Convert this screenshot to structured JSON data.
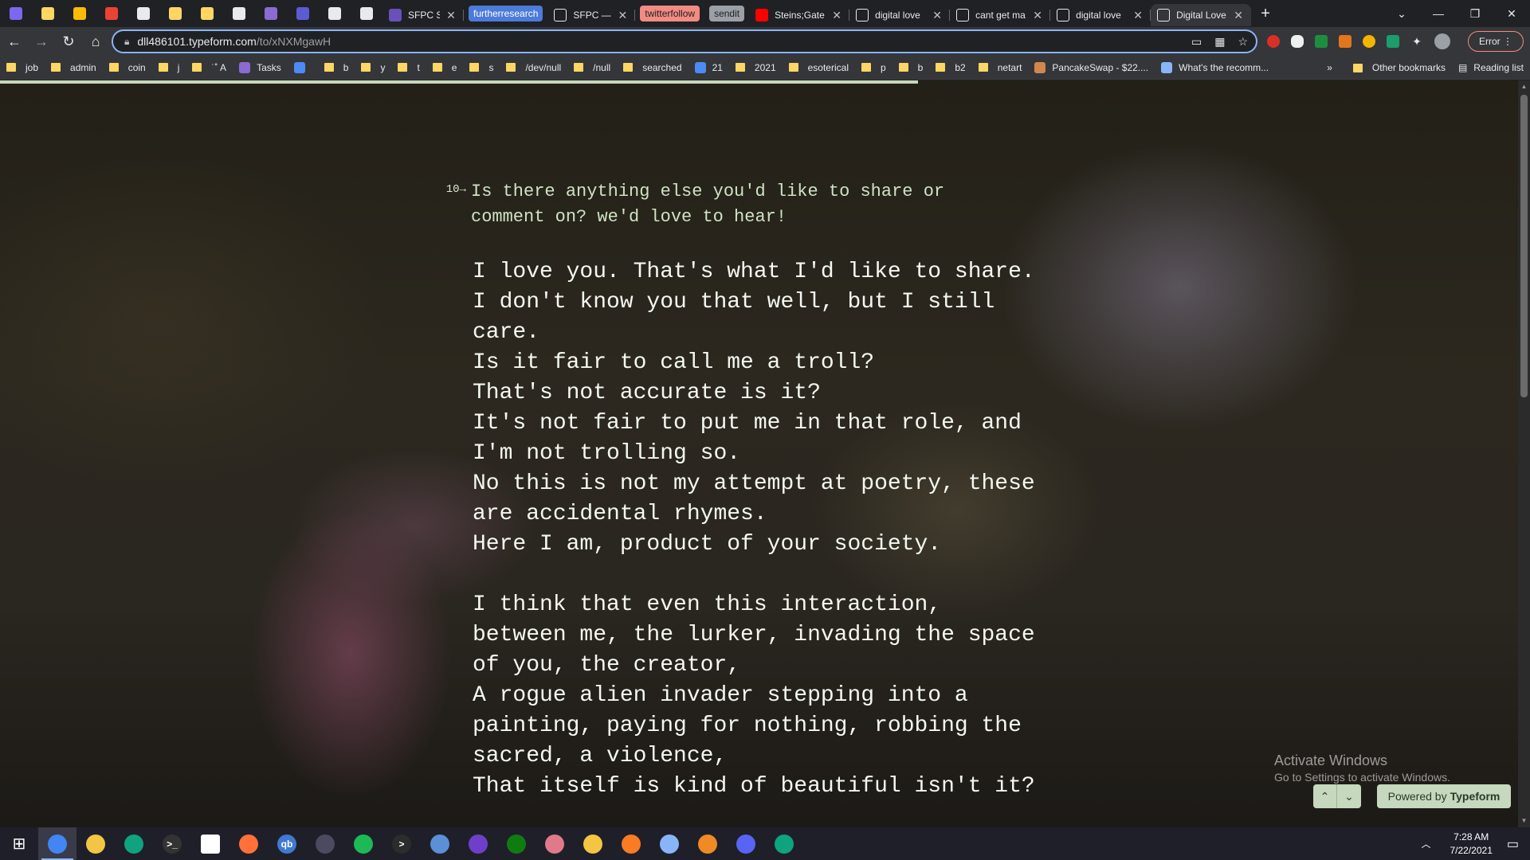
{
  "browser": {
    "pinned_tabs": [
      {
        "icon": "messenger-icon",
        "color": "#7b68ee"
      },
      {
        "icon": "g-icon",
        "color": "#fdd663"
      },
      {
        "icon": "google-keep-icon",
        "color": "#fbbc04"
      },
      {
        "icon": "gmail-icon",
        "color": "#ea4335"
      },
      {
        "icon": "circle-icon",
        "color": "#e8eaed"
      },
      {
        "icon": "notes-icon",
        "color": "#fdd663"
      },
      {
        "icon": "notes-icon",
        "color": "#fdd663"
      },
      {
        "icon": "grid-icon",
        "color": "#e8eaed"
      },
      {
        "icon": "puzzle-icon",
        "color": "#8a6bd1"
      },
      {
        "icon": "ring-icon",
        "color": "#5b5bd6"
      },
      {
        "icon": "circle-icon",
        "color": "#e8eaed"
      },
      {
        "icon": "square-icon",
        "color": "#e8eaed"
      }
    ],
    "tabs": [
      {
        "title": "SFPC Summ",
        "icon": "form-icon",
        "icon_color": "#6b4fbb",
        "width": 102,
        "close": "✕"
      },
      {
        "chip": "furtherresearch",
        "chip_bg": "#4c7bd9",
        "chip_fg": "#ffffff"
      },
      {
        "title": "SFPC — CO",
        "icon": "feather-icon",
        "icon_color": "#e8eaed",
        "width": 110,
        "close": "✕"
      },
      {
        "chip": "twitterfollow",
        "chip_bg": "#f28b82",
        "chip_fg": "#202124"
      },
      {
        "chip": "sendit",
        "chip_bg": "#9aa0a6",
        "chip_fg": "#202124"
      },
      {
        "title": "Steins;Gate",
        "icon": "youtube-icon",
        "icon_color": "#ff0000",
        "width": 126,
        "close": "✕"
      },
      {
        "title": "digital love",
        "icon": "heart-icon",
        "icon_color": "#e8eaed",
        "width": 126,
        "close": "✕"
      },
      {
        "title": "cant get ma",
        "icon": "google-icon",
        "icon_color": "#e8eaed",
        "width": 126,
        "close": "✕"
      },
      {
        "title": "digital love",
        "icon": "heart-icon",
        "icon_color": "#e8eaed",
        "width": 126,
        "close": "✕"
      },
      {
        "title": "Digital Love",
        "icon": "typeform-icon",
        "icon_color": "#e8eaed",
        "width": 126,
        "close": "✕",
        "active": true
      }
    ],
    "new_tab": "+",
    "url_host": "dll486101.typeform.com",
    "url_path": "/to/xNXMgawH",
    "error_label": "Error",
    "bookmarks": [
      {
        "label": "job",
        "type": "folder"
      },
      {
        "label": "admin",
        "type": "folder"
      },
      {
        "label": "coin",
        "type": "folder"
      },
      {
        "label": "j",
        "type": "folder"
      },
      {
        "label": "˙˚ A",
        "type": "folder"
      },
      {
        "label": "Tasks",
        "type": "site",
        "color": "#8a6bd1"
      },
      {
        "label": "",
        "type": "site",
        "color": "#4c8bf5"
      },
      {
        "label": "b",
        "type": "folder"
      },
      {
        "label": "y",
        "type": "folder"
      },
      {
        "label": "t",
        "type": "folder"
      },
      {
        "label": "e",
        "type": "folder"
      },
      {
        "label": "s",
        "type": "folder"
      },
      {
        "label": "/dev/null",
        "type": "folder"
      },
      {
        "label": "/null",
        "type": "folder"
      },
      {
        "label": "searched",
        "type": "folder"
      },
      {
        "label": "21",
        "type": "site",
        "color": "#4c8bf5"
      },
      {
        "label": "2021",
        "type": "folder"
      },
      {
        "label": "esoterical",
        "type": "folder"
      },
      {
        "label": "p",
        "type": "folder"
      },
      {
        "label": "b",
        "type": "folder"
      },
      {
        "label": "b2",
        "type": "folder"
      },
      {
        "label": "netart",
        "type": "folder"
      },
      {
        "label": "PancakeSwap - $22....",
        "type": "site",
        "color": "#d1884f"
      },
      {
        "label": "What's the recomm...",
        "type": "site",
        "color": "#8ab4f8"
      }
    ],
    "bookmarks_more": "»",
    "other_bookmarks": "Other bookmarks",
    "reading_list": "Reading list"
  },
  "form": {
    "progress": 0.6,
    "question_number": "10→",
    "question": "Is there anything else you'd like to share or comment on? we'd love to hear!",
    "answer": "I love you. That's what I'd like to share. I don't know you that well, but I still care.\nIs it fair to call me a troll?\nThat's not accurate is it?\nIt's not fair to put me in that role, and I'm not trolling so.\nNo this is not my attempt at poetry, these are accidental rhymes.\nHere I am, product of your society.\n\nI think that even this interaction, between me, the lurker, invading the space of you, the creator,\nA rogue alien invader stepping into a painting, paying for nothing, robbing the sacred, a violence,\nThat itself is kind of beautiful isn't it?",
    "nav_up": "⌃",
    "nav_down": "⌄",
    "powered_by": "Powered by",
    "powered_brand": "Typeform"
  },
  "watermark": {
    "line1": "Activate Windows",
    "line2": "Go to Settings to activate Windows."
  },
  "taskbar": {
    "apps": [
      {
        "icon": "windows-start-icon",
        "color": "#1f1f2a",
        "glyph": "⊞"
      },
      {
        "icon": "chrome-icon",
        "color": "#4285f4",
        "active": true
      },
      {
        "icon": "file-explorer-icon",
        "color": "#f4c542"
      },
      {
        "icon": "chatgpt-icon",
        "color": "#10a37f"
      },
      {
        "icon": "terminal-icon",
        "color": "#333333",
        "glyph": ">_"
      },
      {
        "icon": "window-icon",
        "color": "#ffffff"
      },
      {
        "icon": "firefox-icon",
        "color": "#ff7139"
      },
      {
        "icon": "qbittorrent-icon",
        "color": "#3f79d3",
        "glyph": "qb"
      },
      {
        "icon": "vpn-icon",
        "color": "#4a4a60"
      },
      {
        "icon": "spotify-icon",
        "color": "#1db954"
      },
      {
        "icon": "shell-icon",
        "color": "#2c2c2c",
        "glyph": ">"
      },
      {
        "icon": "virtualbox-icon",
        "color": "#5b8fd6"
      },
      {
        "icon": "github-icon",
        "color": "#6e40c9"
      },
      {
        "icon": "xbox-icon",
        "color": "#107c10"
      },
      {
        "icon": "brain-icon",
        "color": "#e07a8a"
      },
      {
        "icon": "film-icon",
        "color": "#f4c542"
      },
      {
        "icon": "xampp-icon",
        "color": "#fb7a24"
      },
      {
        "icon": "notes-app-icon",
        "color": "#8ab4f8"
      },
      {
        "icon": "vlc-icon",
        "color": "#f08a24"
      },
      {
        "icon": "discord-icon",
        "color": "#5865f2"
      },
      {
        "icon": "chatgpt-icon",
        "color": "#10a37f"
      }
    ],
    "time": "7:28 AM",
    "date": "7/22/2021"
  }
}
